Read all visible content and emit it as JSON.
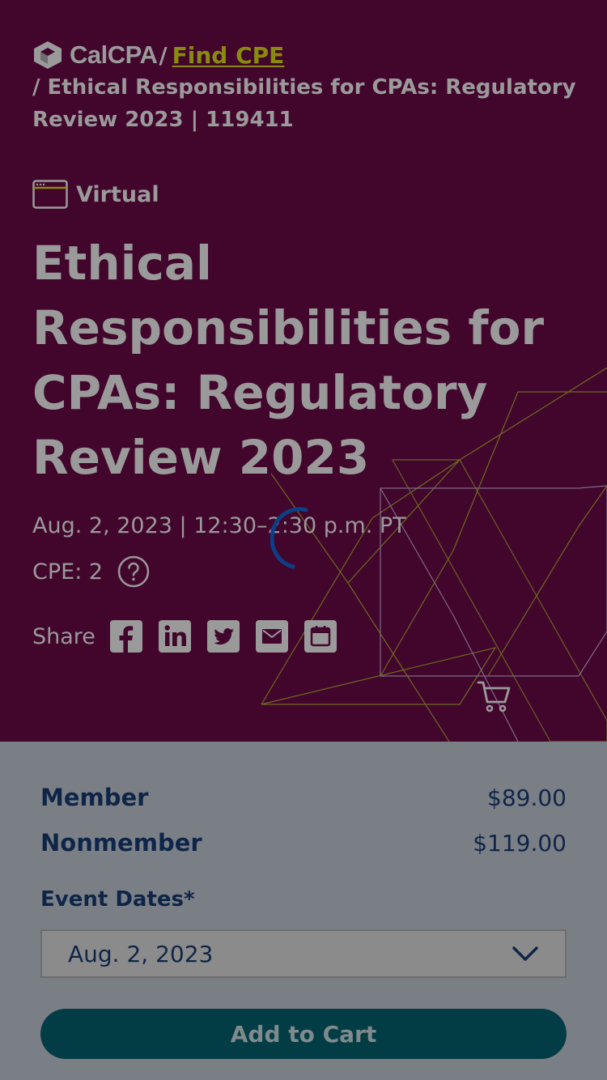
{
  "header": {
    "logo_text": "CalCPA",
    "crumb_sep": "/",
    "find_cpe": "Find CPE",
    "crumb_current": "/ Ethical Responsibilities for CPAs: Regulatory Review 2023 | 119411"
  },
  "event": {
    "format_icon": "browser-window-icon",
    "format": "Virtual",
    "title": "Ethical Responsibilities for CPAs: Regulatory Review 2023",
    "date_time": "Aug. 2, 2023 | 12:30–2:30 p.m. PT",
    "cpe": "CPE: 2",
    "share_label": "Share",
    "share_icons": [
      "facebook-icon",
      "linkedin-icon",
      "twitter-icon",
      "email-icon",
      "calendar-icon"
    ]
  },
  "pricing": {
    "rows": [
      {
        "label": "Member",
        "price": "$89.00"
      },
      {
        "label": "Nonmember",
        "price": "$119.00"
      }
    ],
    "event_dates_label": "Event Dates*",
    "selected_date": "Aug. 2, 2023",
    "add_to_cart": "Add to Cart"
  },
  "colors": {
    "hero_bg": "#42062c",
    "overlay_text": "#9a9a9a",
    "accent_link": "#8a8a10",
    "navy": "#0f2548",
    "button_bg": "#023d45",
    "spinner": "#0d3f86"
  }
}
